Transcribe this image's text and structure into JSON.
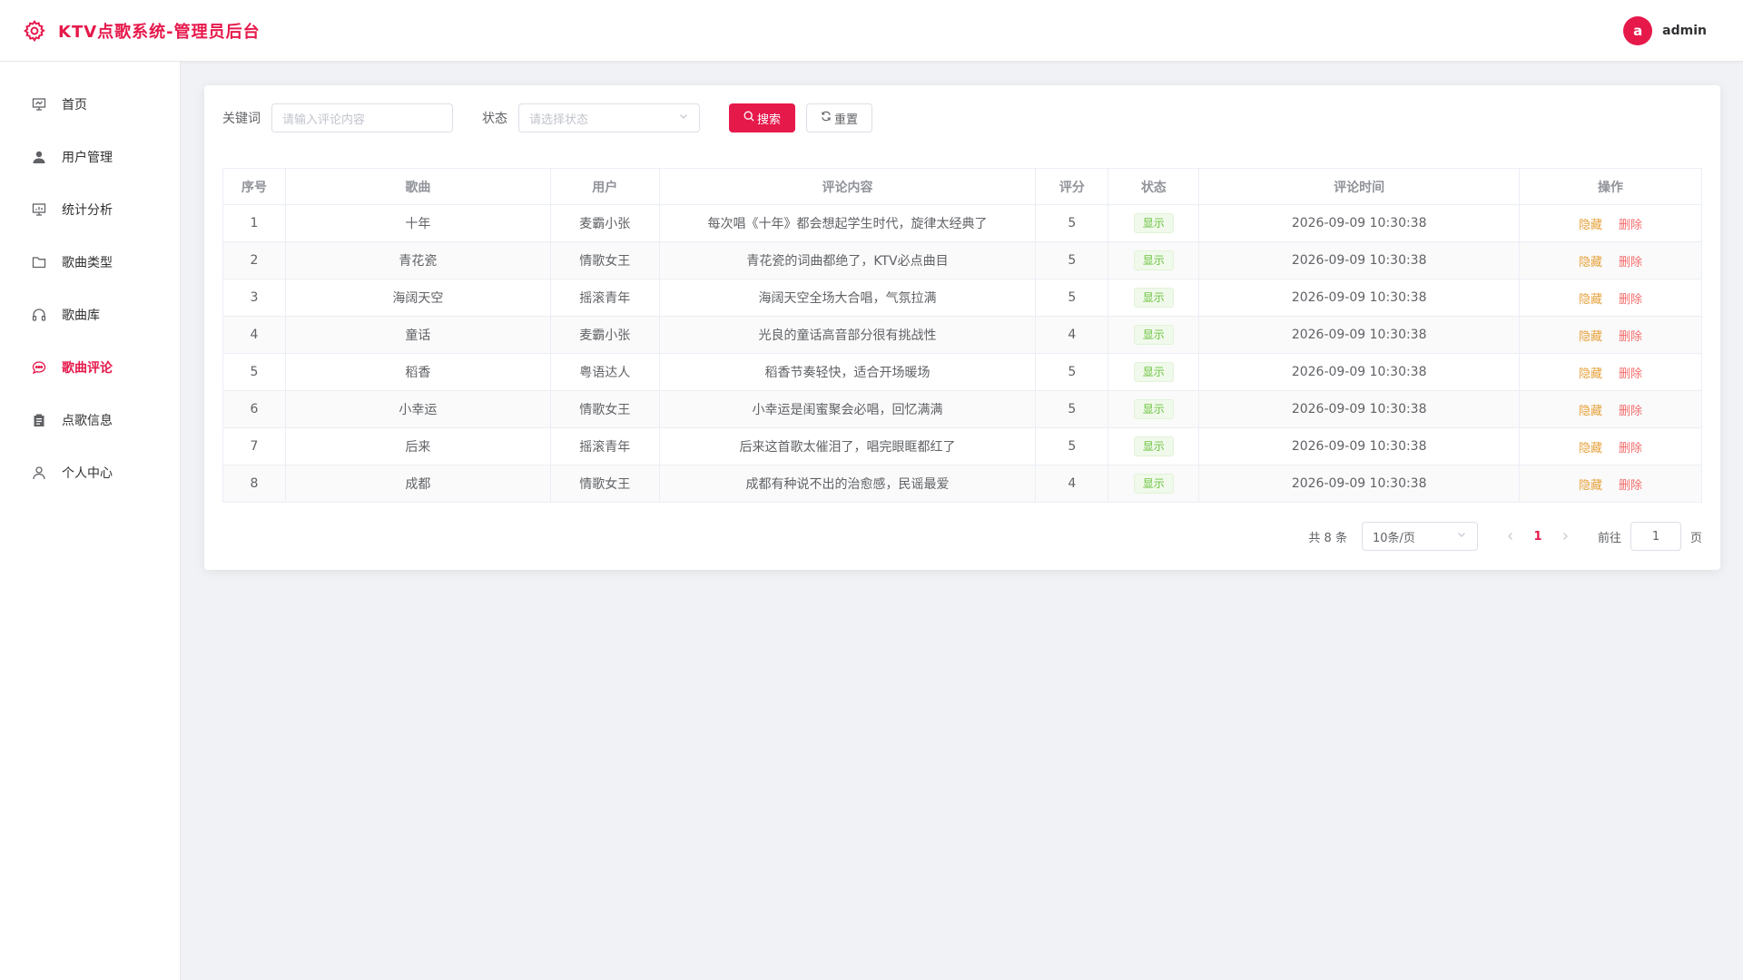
{
  "header": {
    "title": "KTV点歌系统-管理员后台",
    "avatar_letter": "a",
    "username": "admin",
    "brand_color": "#e6194b"
  },
  "sidebar": {
    "items": [
      {
        "icon": "presentation-icon",
        "label": "首页",
        "active": false
      },
      {
        "icon": "user-icon",
        "label": "用户管理",
        "active": false
      },
      {
        "icon": "chart-board-icon",
        "label": "统计分析",
        "active": false
      },
      {
        "icon": "folder-icon",
        "label": "歌曲类型",
        "active": false
      },
      {
        "icon": "headset-icon",
        "label": "歌曲库",
        "active": false
      },
      {
        "icon": "chat-dots-icon",
        "label": "歌曲评论",
        "active": true
      },
      {
        "icon": "clipboard-icon",
        "label": "点歌信息",
        "active": false
      },
      {
        "icon": "person-icon",
        "label": "个人中心",
        "active": false
      }
    ]
  },
  "filters": {
    "keyword_label": "关键词",
    "keyword_placeholder": "请输入评论内容",
    "status_label": "状态",
    "status_placeholder": "请选择状态",
    "search_label": "搜索",
    "reset_label": "重置"
  },
  "table": {
    "columns": [
      "序号",
      "歌曲",
      "用户",
      "评论内容",
      "评分",
      "状态",
      "评论时间",
      "操作"
    ],
    "rows": [
      {
        "no": "1",
        "song": "十年",
        "user": "麦霸小张",
        "content": "每次唱《十年》都会想起学生时代，旋律太经典了",
        "score": "5",
        "status": "显示",
        "time": "2026-09-09 10:30:38"
      },
      {
        "no": "2",
        "song": "青花瓷",
        "user": "情歌女王",
        "content": "青花瓷的词曲都绝了，KTV必点曲目",
        "score": "5",
        "status": "显示",
        "time": "2026-09-09 10:30:38"
      },
      {
        "no": "3",
        "song": "海阔天空",
        "user": "摇滚青年",
        "content": "海阔天空全场大合唱，气氛拉满",
        "score": "5",
        "status": "显示",
        "time": "2026-09-09 10:30:38"
      },
      {
        "no": "4",
        "song": "童话",
        "user": "麦霸小张",
        "content": "光良的童话高音部分很有挑战性",
        "score": "4",
        "status": "显示",
        "time": "2026-09-09 10:30:38"
      },
      {
        "no": "5",
        "song": "稻香",
        "user": "粤语达人",
        "content": "稻香节奏轻快，适合开场暖场",
        "score": "5",
        "status": "显示",
        "time": "2026-09-09 10:30:38"
      },
      {
        "no": "6",
        "song": "小幸运",
        "user": "情歌女王",
        "content": "小幸运是闺蜜聚会必唱，回忆满满",
        "score": "5",
        "status": "显示",
        "time": "2026-09-09 10:30:38"
      },
      {
        "no": "7",
        "song": "后来",
        "user": "摇滚青年",
        "content": "后来这首歌太催泪了，唱完眼眶都红了",
        "score": "5",
        "status": "显示",
        "time": "2026-09-09 10:30:38"
      },
      {
        "no": "8",
        "song": "成都",
        "user": "情歌女王",
        "content": "成都有种说不出的治愈感，民谣最爱",
        "score": "4",
        "status": "显示",
        "time": "2026-09-09 10:30:38"
      }
    ],
    "action_hide": "隐藏",
    "action_delete": "删除"
  },
  "pagination": {
    "total_text": "共 8 条",
    "page_size": "10条/页",
    "current_page": "1",
    "goto_label": "前往",
    "goto_value": "1",
    "page_suffix": "页"
  }
}
